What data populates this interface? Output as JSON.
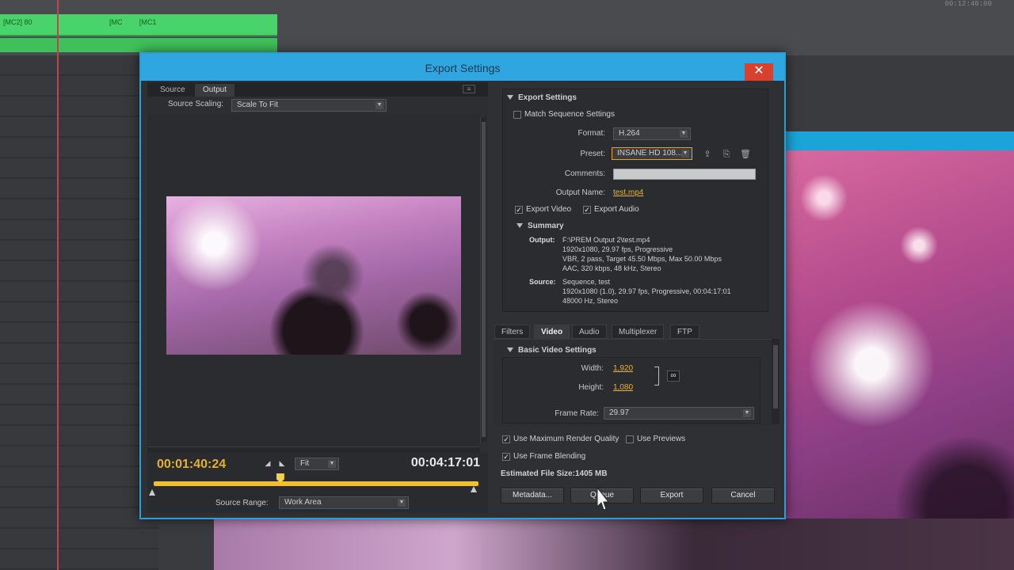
{
  "background": {
    "timeline_clip_labels": [
      "[MC2] 80",
      "[MC",
      "[MC1"
    ],
    "timecode": "00:12:40:00"
  },
  "dialog": {
    "title": "Export Settings",
    "close_glyph": "✕"
  },
  "left_panel": {
    "tabs": [
      {
        "label": "Source",
        "active": false
      },
      {
        "label": "Output",
        "active": true
      }
    ],
    "source_scaling_label": "Source Scaling:",
    "source_scaling_value": "Scale To Fit",
    "current_timecode": "00:01:40:24",
    "duration_timecode": "00:04:17:01",
    "fit_value": "Fit",
    "playhead_fraction": 0.39,
    "source_range_label": "Source Range:",
    "source_range_value": "Work Area"
  },
  "export_settings": {
    "section_title": "Export Settings",
    "match_sequence_label": "Match Sequence Settings",
    "match_sequence_checked": false,
    "format_label": "Format:",
    "format_value": "H.264",
    "preset_label": "Preset:",
    "preset_value": "INSANE HD 108...",
    "comments_label": "Comments:",
    "comments_value": "",
    "output_name_label": "Output Name:",
    "output_name_value": "test.mp4",
    "export_video_label": "Export Video",
    "export_video_checked": true,
    "export_audio_label": "Export Audio",
    "export_audio_checked": true
  },
  "summary": {
    "title": "Summary",
    "output_key": "Output:",
    "output_lines": [
      "F:\\PREM Output 2\\test.mp4",
      "1920x1080, 29.97 fps, Progressive",
      "VBR, 2 pass, Target 45.50 Mbps, Max 50.00 Mbps",
      "AAC, 320 kbps, 48 kHz, Stereo"
    ],
    "source_key": "Source:",
    "source_lines": [
      "Sequence, test",
      "1920x1080 (1.0), 29.97 fps, Progressive, 00:04:17:01",
      "48000 Hz, Stereo"
    ]
  },
  "right_tabs": [
    {
      "label": "Filters",
      "active": false
    },
    {
      "label": "Video",
      "active": true
    },
    {
      "label": "Audio",
      "active": false
    },
    {
      "label": "Multiplexer",
      "active": false
    },
    {
      "label": "FTP",
      "active": false
    }
  ],
  "basic_video": {
    "title": "Basic Video Settings",
    "width_label": "Width:",
    "width_value": "1,920",
    "height_label": "Height:",
    "height_value": "1,080",
    "frame_rate_label": "Frame Rate:",
    "frame_rate_value": "29.97"
  },
  "options": {
    "max_render_label": "Use Maximum Render Quality",
    "max_render_checked": true,
    "use_previews_label": "Use Previews",
    "use_previews_checked": false,
    "frame_blending_label": "Use Frame Blending",
    "frame_blending_checked": true,
    "file_size_label": "Estimated File Size:",
    "file_size_value": "1405 MB"
  },
  "buttons": {
    "metadata": "Metadata...",
    "queue": "Queue",
    "export": "Export",
    "cancel": "Cancel"
  },
  "colors": {
    "title_bar": "#30a6e0",
    "timecode_accent": "#e6b12c",
    "close_button": "#d9412f"
  },
  "icons": {
    "close": "close-icon",
    "checkbox": "checkmark-icon",
    "link": "chain-link-icon"
  }
}
